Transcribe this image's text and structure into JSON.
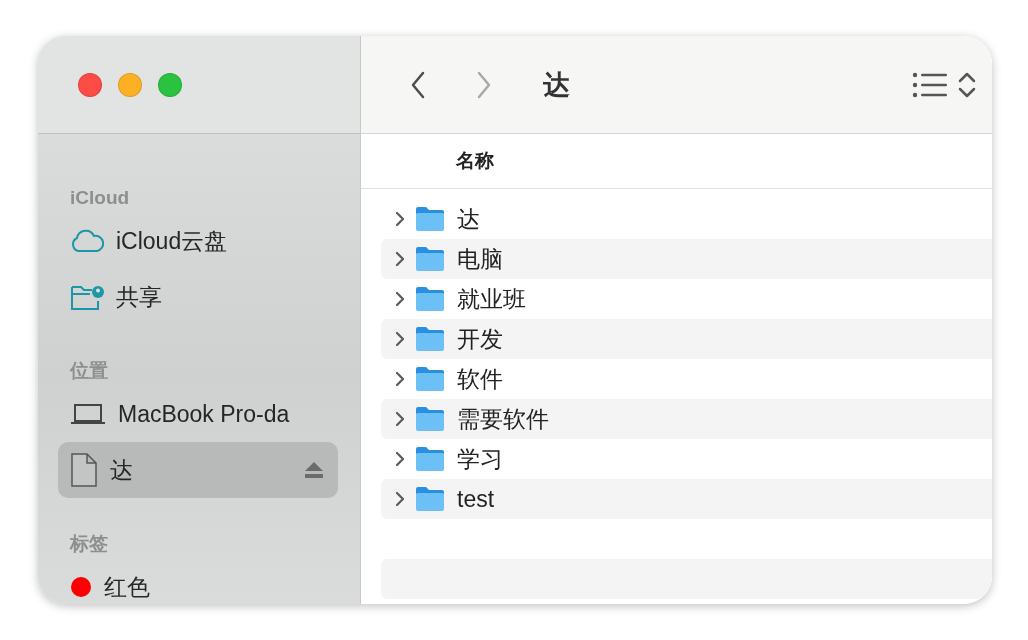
{
  "window": {
    "title": "达"
  },
  "nav_buttons": [
    {
      "kind": "back",
      "disabled": false
    },
    {
      "kind": "forward",
      "disabled": true
    }
  ],
  "sidebar": {
    "sections": [
      {
        "heading": "iCloud",
        "items": [
          {
            "kind": "cloud",
            "label": "iCloud云盘",
            "selected": false,
            "ejectable": false
          },
          {
            "kind": "shared",
            "label": "共享",
            "selected": false,
            "ejectable": false
          }
        ]
      },
      {
        "heading": "位置",
        "items": [
          {
            "kind": "laptop",
            "label": "MacBook Pro-da",
            "selected": false,
            "ejectable": false
          },
          {
            "kind": "disk",
            "label": "达",
            "selected": true,
            "ejectable": true
          }
        ]
      },
      {
        "heading": "标签",
        "items": [
          {
            "kind": "tag",
            "label": "红色",
            "selected": false,
            "ejectable": false,
            "color": "#ff0000"
          }
        ]
      }
    ]
  },
  "file_list": {
    "columns": [
      "名称"
    ],
    "rows": [
      {
        "name": "达",
        "expanded": false
      },
      {
        "name": "电脑",
        "expanded": false
      },
      {
        "name": "就业班",
        "expanded": false
      },
      {
        "name": "开发",
        "expanded": false
      },
      {
        "name": "软件",
        "expanded": false
      },
      {
        "name": "需要软件",
        "expanded": false
      },
      {
        "name": "学习",
        "expanded": false
      },
      {
        "name": "test",
        "expanded": false
      }
    ]
  }
}
